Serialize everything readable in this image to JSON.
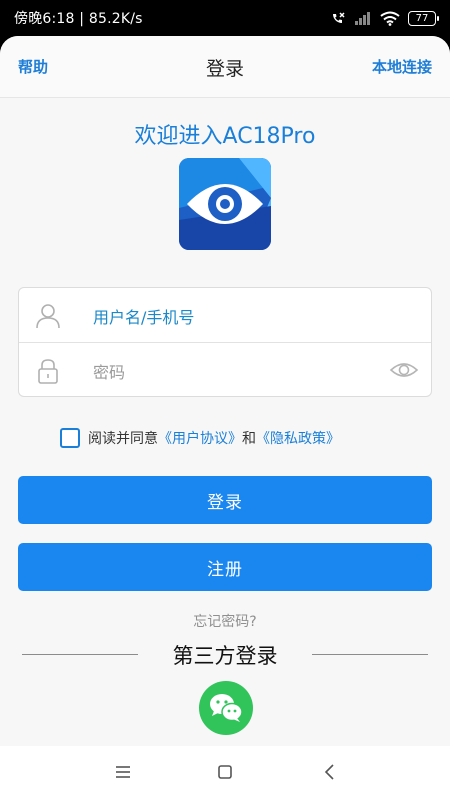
{
  "status_bar": {
    "time_speed": "傍晚6:18 | 85.2K/s",
    "battery": "77"
  },
  "nav": {
    "help": "帮助",
    "title": "登录",
    "local_connect": "本地连接"
  },
  "welcome": "欢迎进入AC18Pro",
  "form": {
    "username_placeholder": "用户名/手机号",
    "password_placeholder": "密码"
  },
  "agreement": {
    "prefix": "阅读并同意",
    "user_agreement": "《用户协议》",
    "and": "和",
    "privacy_policy": "《隐私政策》"
  },
  "buttons": {
    "login": "登录",
    "register": "注册"
  },
  "forgot_password": "忘记密码?",
  "third_party": "第三方登录",
  "colors": {
    "accent": "#1a86f0",
    "link": "#1a7fd9",
    "wechat": "#30c45a"
  },
  "icons": [
    "user-icon",
    "lock-icon",
    "eye-icon",
    "wechat-icon",
    "menu-icon",
    "home-icon",
    "back-icon"
  ]
}
